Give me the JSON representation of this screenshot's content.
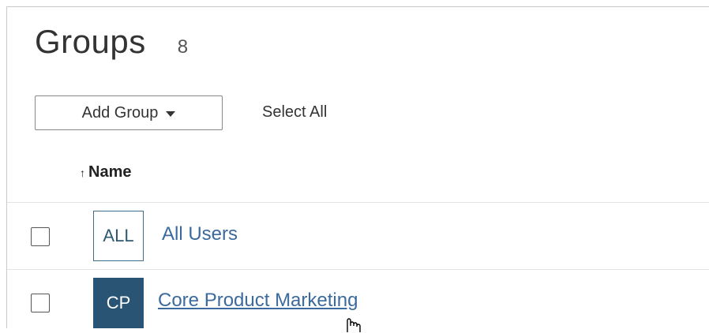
{
  "header": {
    "title": "Groups",
    "count": "8"
  },
  "toolbar": {
    "add_group_label": "Add Group",
    "select_all_label": "Select All"
  },
  "table": {
    "sort_column": "Name",
    "sort_direction_icon": "arrow-up-icon",
    "rows": [
      {
        "avatar": "ALL",
        "avatar_style": "outline",
        "name": "All Users",
        "checked": false
      },
      {
        "avatar": "CP",
        "avatar_style": "filled",
        "name": "Core Product Marketing",
        "checked": false
      }
    ]
  },
  "colors": {
    "link": "#3b6a9e",
    "avatar_dark": "#2a5473",
    "border": "#c9c9c9"
  }
}
